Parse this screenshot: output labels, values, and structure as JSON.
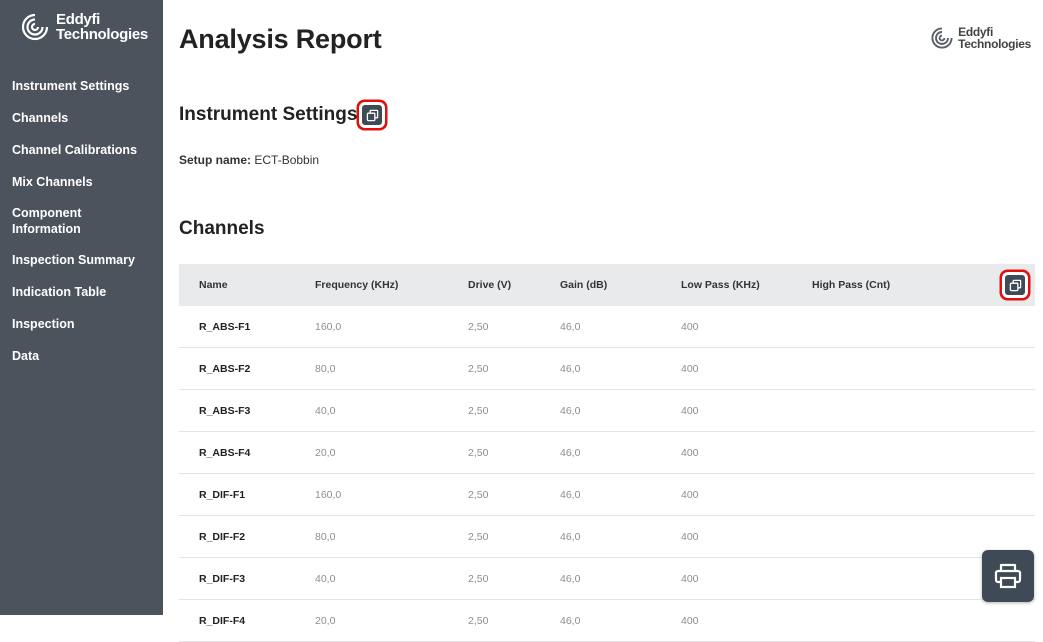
{
  "sidebar": {
    "logo": {
      "line1": "Eddyfi",
      "line2": "Technologies"
    },
    "items": [
      {
        "label": "Instrument Settings"
      },
      {
        "label": "Channels"
      },
      {
        "label": "Channel Calibrations"
      },
      {
        "label": "Mix Channels"
      },
      {
        "label": "Component Information"
      },
      {
        "label": "Inspection Summary"
      },
      {
        "label": "Indication Table"
      },
      {
        "label": "Inspection"
      },
      {
        "label": "Data"
      }
    ]
  },
  "header": {
    "title": "Analysis Report",
    "brand": {
      "line1": "Eddyfi",
      "line2": "Technologies"
    }
  },
  "instrument_settings": {
    "title": "Instrument Settings",
    "setup_label": "Setup name:",
    "setup_value": "ECT-Bobbin"
  },
  "channels": {
    "title": "Channels",
    "columns": [
      "Name",
      "Frequency (KHz)",
      "Drive (V)",
      "Gain (dB)",
      "Low Pass (KHz)",
      "High Pass (Cnt)"
    ],
    "rows": [
      [
        "R_ABS-F1",
        "160,0",
        "2,50",
        "46,0",
        "400",
        ""
      ],
      [
        "R_ABS-F2",
        "80,0",
        "2,50",
        "46,0",
        "400",
        ""
      ],
      [
        "R_ABS-F3",
        "40,0",
        "2,50",
        "46,0",
        "400",
        ""
      ],
      [
        "R_ABS-F4",
        "20,0",
        "2,50",
        "46,0",
        "400",
        ""
      ],
      [
        "R_DIF-F1",
        "160,0",
        "2,50",
        "46,0",
        "400",
        ""
      ],
      [
        "R_DIF-F2",
        "80,0",
        "2,50",
        "46,0",
        "400",
        ""
      ],
      [
        "R_DIF-F3",
        "40,0",
        "2,50",
        "46,0",
        "400",
        ""
      ],
      [
        "R_DIF-F4",
        "20,0",
        "2,50",
        "46,0",
        "400",
        ""
      ]
    ]
  },
  "icons": {
    "copy": "copy-icon",
    "print": "printer-icon",
    "logo": "eddyfi-logo-icon"
  },
  "colors": {
    "sidebar": "#4b535c",
    "button": "#3e4a56",
    "highlight": "#e01010",
    "table_header": "#e9eaec"
  }
}
